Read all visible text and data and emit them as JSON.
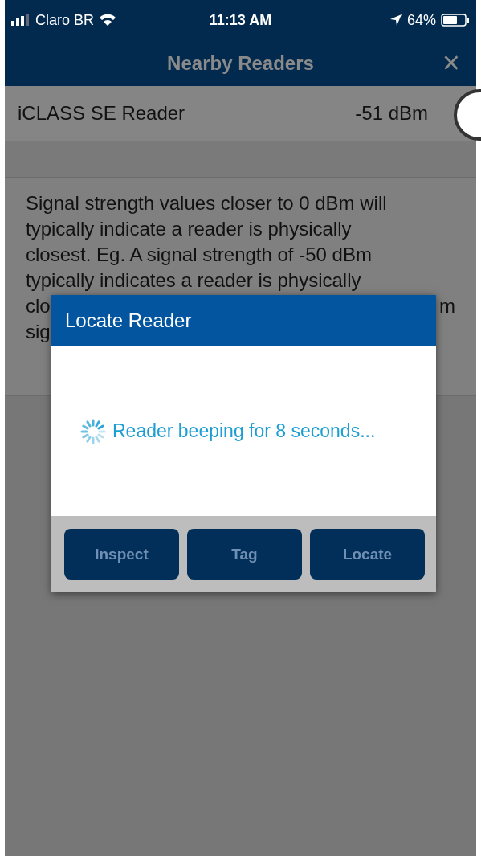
{
  "status_bar": {
    "carrier": "Claro BR",
    "time": "11:13 AM",
    "battery": "64%"
  },
  "nav_bar": {
    "title": "Nearby Readers",
    "close": "×"
  },
  "readers": [
    {
      "name": "iCLASS SE Reader",
      "signal": "-51 dBm"
    }
  ],
  "info_lines": [
    {
      "left": "Signal strength values closer to 0 dBm will"
    },
    {
      "left": "typically indicate a reader is physically"
    },
    {
      "left": "closest. Eg. A signal strength of -50 dBm"
    },
    {
      "left": "typically indicates a reader is physically"
    },
    {
      "left": "clo",
      "right": "m"
    },
    {
      "left": "sig"
    }
  ],
  "dialog": {
    "title": "Locate Reader",
    "message": "Reader beeping for 8 seconds...",
    "buttons": [
      {
        "label": "Inspect",
        "disabled": true
      },
      {
        "label": "Tag",
        "disabled": true
      },
      {
        "label": "Locate",
        "disabled": true
      }
    ]
  }
}
